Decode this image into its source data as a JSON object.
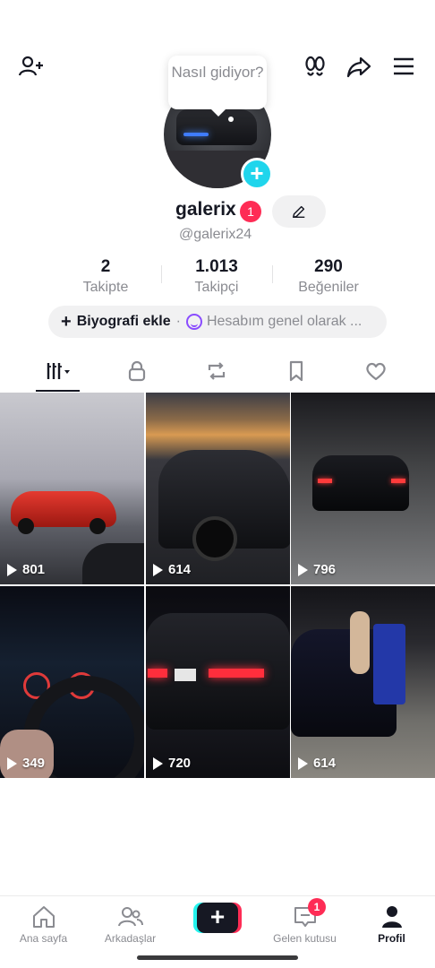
{
  "tooltip": {
    "text": "Nasıl gidiyor?"
  },
  "profile": {
    "username": "galerix",
    "notification_count": "1",
    "handle": "@galerix24"
  },
  "stats": [
    {
      "value": "2",
      "label": "Takipte"
    },
    {
      "value": "1.013",
      "label": "Takipçi"
    },
    {
      "value": "290",
      "label": "Beğeniler"
    }
  ],
  "bio": {
    "add_label": "Biyografi ekle",
    "separator": "·",
    "status_text": "Hesabım genel olarak ..."
  },
  "videos": [
    {
      "views": "801"
    },
    {
      "views": "614"
    },
    {
      "views": "796"
    },
    {
      "views": "349"
    },
    {
      "views": "720"
    },
    {
      "views": "614"
    }
  ],
  "bottom_nav": {
    "home": "Ana sayfa",
    "friends": "Arkadaşlar",
    "create": "+",
    "inbox": "Gelen kutusu",
    "inbox_badge": "1",
    "profile": "Profil"
  },
  "colors": {
    "accent": "#fe2c55",
    "cyan": "#25f4ee",
    "text_primary": "#161823",
    "text_secondary": "#8a8b91"
  },
  "icons": [
    "add-friend-icon",
    "footprints-icon",
    "share-icon",
    "menu-icon",
    "edit-icon",
    "grid-icon",
    "lock-icon",
    "repost-icon",
    "bookmark-icon",
    "heart-icon",
    "home-icon",
    "friends-icon",
    "inbox-icon",
    "profile-icon"
  ]
}
